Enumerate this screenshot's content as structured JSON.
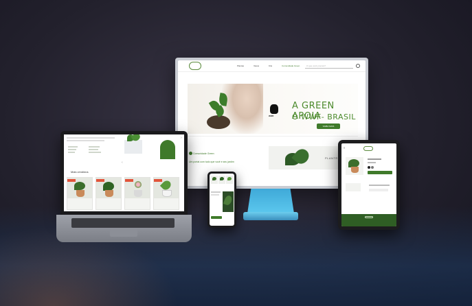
{
  "colors": {
    "brand_green": "#3f7a2a",
    "sale_badge": "#e2543b",
    "stand_blue": "#4cb8e4"
  },
  "monitor": {
    "nav": {
      "links": [
        "Plantas",
        "Vasos",
        "Kits",
        "Comunidade Green"
      ],
      "search_placeholder": "O que você procura?"
    },
    "banner": {
      "headline_line1": "A GREEN APOIA",
      "headline_line2": "O WWF- BRASIL",
      "partner": "WWF",
      "button": "SAIBA MAIS"
    },
    "community": {
      "title": "Comunidade Green",
      "subtitle": "Um portal com tudo que você e seu jardim"
    },
    "partner_logo": "PLANTRY"
  },
  "laptop": {
    "section_title": "Mais vendidos"
  },
  "icons": [
    "search-icon",
    "wwf-panda-icon",
    "chevron-left-icon",
    "chevron-right-icon",
    "cart-icon",
    "heart-icon"
  ]
}
